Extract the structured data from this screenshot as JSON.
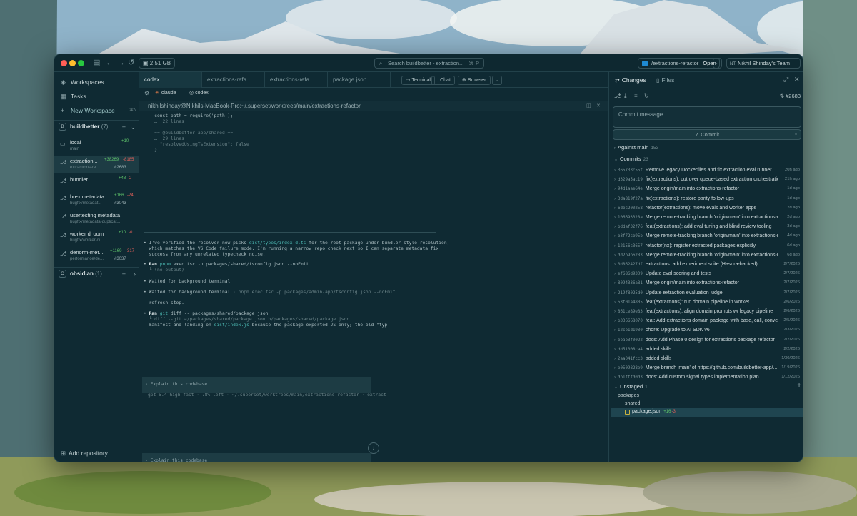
{
  "titlebar": {
    "ram": "2.51 GB",
    "search_placeholder": "Search buildbetter - extraction...",
    "search_kbd": "⌘ P",
    "branch": "/extractions-refactor",
    "open_label": "Open",
    "team_initials": "NT",
    "team": "Nikhil Shinday's Team"
  },
  "sidebar": {
    "nav": [
      {
        "label": "Workspaces"
      },
      {
        "label": "Tasks"
      },
      {
        "label": "New Workspace",
        "shortcut": "⌘N"
      }
    ],
    "repos": [
      {
        "badge": "B",
        "name": "buildbetter",
        "count": "(7)"
      },
      {
        "badge": "O",
        "name": "obsidian",
        "count": "(1)"
      }
    ],
    "workspaces": [
      {
        "title": "local",
        "sub": "main",
        "add": "+10",
        "del": "",
        "pr": ""
      },
      {
        "title": "extraction...",
        "sub": "extractions-re...",
        "add": "+38269",
        "del": "-8185",
        "pr": "#2683"
      },
      {
        "title": "bundler",
        "sub": "",
        "add": "+48",
        "del": "-2",
        "pr": ""
      },
      {
        "title": "brex metadata",
        "sub": "bugfix/metadat...",
        "add": "+166",
        "del": "-24",
        "pr": "#3043"
      },
      {
        "title": "usertesting metadata",
        "sub": "bugfix/metadata-duplicat...",
        "add": "",
        "del": "",
        "pr": ""
      },
      {
        "title": "worker di oom",
        "sub": "bugfix/worker-di",
        "add": "+10",
        "del": "-0",
        "pr": ""
      },
      {
        "title": "denorm-met...",
        "sub": "performance/de...",
        "add": "+1169",
        "del": "-317",
        "pr": "#3037"
      }
    ],
    "add_repo": "Add repository"
  },
  "center": {
    "tabs": [
      "codex",
      "extractions-refa...",
      "extractions-refa...",
      "package.json"
    ],
    "buttons": {
      "terminal": "Terminal",
      "chat": "Chat",
      "browser": "Browser"
    },
    "agents": [
      "claude",
      "codex"
    ],
    "path": "nikhilshinday@Nikhils-MacBook-Pro:~/.superset/worktrees/main/extractions-refactor",
    "terminal_lines": [
      "    const path = require('path');",
      "    … +22 lines",
      "",
      "    == @buildbetter-app/shared ==",
      "    … +29 lines",
      "      \"resolvedUsingTsExtension\": false",
      "    }"
    ],
    "msg1_a": "• I've verified the resolver now picks ",
    "msg1_b": "dist/types/index.d.ts",
    "msg1_c": " for the root package under bundler-style resolution,",
    "msg1_d": "  which matches the VS Code failure mode. I'm running a narrow repo check next so I can separate metadata fix",
    "msg1_e": "  success from any unrelated typecheck noise.",
    "ran1_label": "Ran",
    "ran1_cmd_a": "pnpm",
    "ran1_cmd_b": " exec tsc -p packages/shared/tsconfig.json --noEmit",
    "ran1_out": "  └ (no output)",
    "wait1": "• Waited for background terminal",
    "wait2_a": "• Waited for background terminal",
    "wait2_b": " · pnpm exec tsc -p packages/admin-app/tsconfig.json --noEmit",
    "refresh": "  refresh step.",
    "ran2_label": "Ran",
    "ran2_cmd_a": "git",
    "ran2_cmd_b": " diff -- packages/shared/package.json",
    "ran2_out": "  └ diff --git a/packages/shared/package.json b/packages/shared/package.json",
    "ran2_tail_a": "  manifest and landing on ",
    "ran2_tail_b": "dist/index.js",
    "ran2_tail_c": " because the package exported JS only; the old \"typ",
    "prompt": "› Explain this codebase",
    "status": "gpt-5.4 high fast · 78% left · ~/.superset/worktrees/main/extractions-refactor · extract"
  },
  "right": {
    "tab_changes": "Changes",
    "tab_files": "Files",
    "pr": "#2683",
    "commit_placeholder": "Commit message",
    "commit_button": "Commit",
    "against": "Against main",
    "against_count": "153",
    "commits_label": "Commits",
    "commits_count": "23",
    "commits": [
      {
        "hash": "365733c55f",
        "msg": "Remove legacy Dockerfiles and fix extraction eval runner",
        "time": "20h ago"
      },
      {
        "hash": "d329a5ac19",
        "msg": "fix(extractions): cut over queue-based extraction orchestration",
        "time": "21h ago"
      },
      {
        "hash": "94d1aae64e",
        "msg": "Merge origin/main into extractions-refactor",
        "time": "1d ago"
      },
      {
        "hash": "3da819f27a",
        "msg": "fix(extractions): restore parity follow-ups",
        "time": "1d ago"
      },
      {
        "hash": "6dbc200258",
        "msg": "refactor(extractions): move evals and worker apps",
        "time": "2d ago"
      },
      {
        "hash": "106693328a",
        "msg": "Merge remote-tracking branch 'origin/main' into extractions-r...",
        "time": "2d ago"
      },
      {
        "hash": "bddaf32f76",
        "msg": "feat(extractions): add eval tuning and blind review tooling",
        "time": "3d ago"
      },
      {
        "hash": "b3f72cb95b",
        "msg": "Merge remote-tracking branch 'origin/main' into extractions-r...",
        "time": "4d ago"
      },
      {
        "hash": "12156c3657",
        "msg": "refactor(nx): register extracted packages explicitly",
        "time": "6d ago"
      },
      {
        "hash": "dd2b9b6283",
        "msg": "Merge remote-tracking branch 'origin/main' into extractions-r...",
        "time": "6d ago"
      },
      {
        "hash": "0d862427df",
        "msg": "extractions: add experiment suite (Hasura-backed)",
        "time": "2/7/2026"
      },
      {
        "hash": "ef686d9309",
        "msg": "Update eval scoring and tests",
        "time": "2/7/2026"
      },
      {
        "hash": "8094336a81",
        "msg": "Merge origin/main into extractions-refactor",
        "time": "2/7/2026"
      },
      {
        "hash": "219f8025d0",
        "msg": "Update extraction evaluation judge",
        "time": "2/7/2026"
      },
      {
        "hash": "53f01a4805",
        "msg": "feat(extractions): run domain pipeline in worker",
        "time": "2/6/2026"
      },
      {
        "hash": "861ce89e83",
        "msg": "feat(extractions): align domain prompts w/ legacy pipeline",
        "time": "2/6/2026"
      },
      {
        "hash": "b336668070",
        "msg": "feat: Add extractions domain package with base, call, conve...",
        "time": "2/5/2026"
      },
      {
        "hash": "12ce1d1930",
        "msg": "chore: Upgrade to AI SDK v6",
        "time": "2/3/2026"
      },
      {
        "hash": "bbab3f0022",
        "msg": "docs: Add Phase 0 design for extractions package refactor",
        "time": "2/2/2026"
      },
      {
        "hash": "dd51008ca4",
        "msg": "added skills",
        "time": "2/2/2026"
      },
      {
        "hash": "2aa041fcc3",
        "msg": "added skills",
        "time": "1/30/2026"
      },
      {
        "hash": "e0509828e9",
        "msg": "Merge branch 'main' of https://github.com/buildbetter-app/...",
        "time": "1/19/2026"
      },
      {
        "hash": "db1fffd0d3",
        "msg": "docs: Add custom signal types implementation plan",
        "time": "1/12/2026"
      }
    ],
    "unstaged_label": "Unstaged",
    "unstaged_count": "1",
    "tree_root": "packages",
    "tree_child": "shared",
    "file": "package.json",
    "file_add": "+16",
    "file_del": "-3"
  }
}
